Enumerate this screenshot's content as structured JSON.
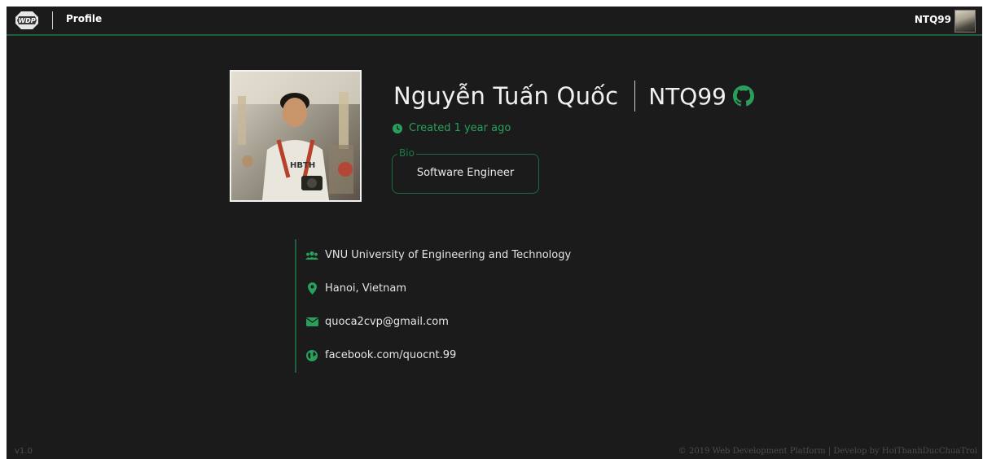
{
  "header": {
    "title": "Profile",
    "username": "NTQ99",
    "logo_text": "WDP"
  },
  "profile": {
    "full_name": "Nguyễn Tuấn Quốc",
    "username": "NTQ99",
    "created": "Created 1 year ago",
    "bio_label": "Bio",
    "bio": "Software Engineer",
    "details": [
      {
        "icon": "users-icon",
        "text": "VNU University of Engineering and Technology"
      },
      {
        "icon": "map-pin-icon",
        "text": "Hanoi, Vietnam"
      },
      {
        "icon": "envelope-icon",
        "text": "quoca2cvp@gmail.com"
      },
      {
        "icon": "globe-icon",
        "text": "facebook.com/quocnt.99"
      }
    ]
  },
  "footer": {
    "version": "v1.0",
    "copyright": "© 2019 Web Development Platform | Develop by HoiThanhDucChuaTroi"
  },
  "colors": {
    "background": "#1b1b1b",
    "accent": "#28a05c",
    "accent_dark": "#1f5e3b"
  }
}
